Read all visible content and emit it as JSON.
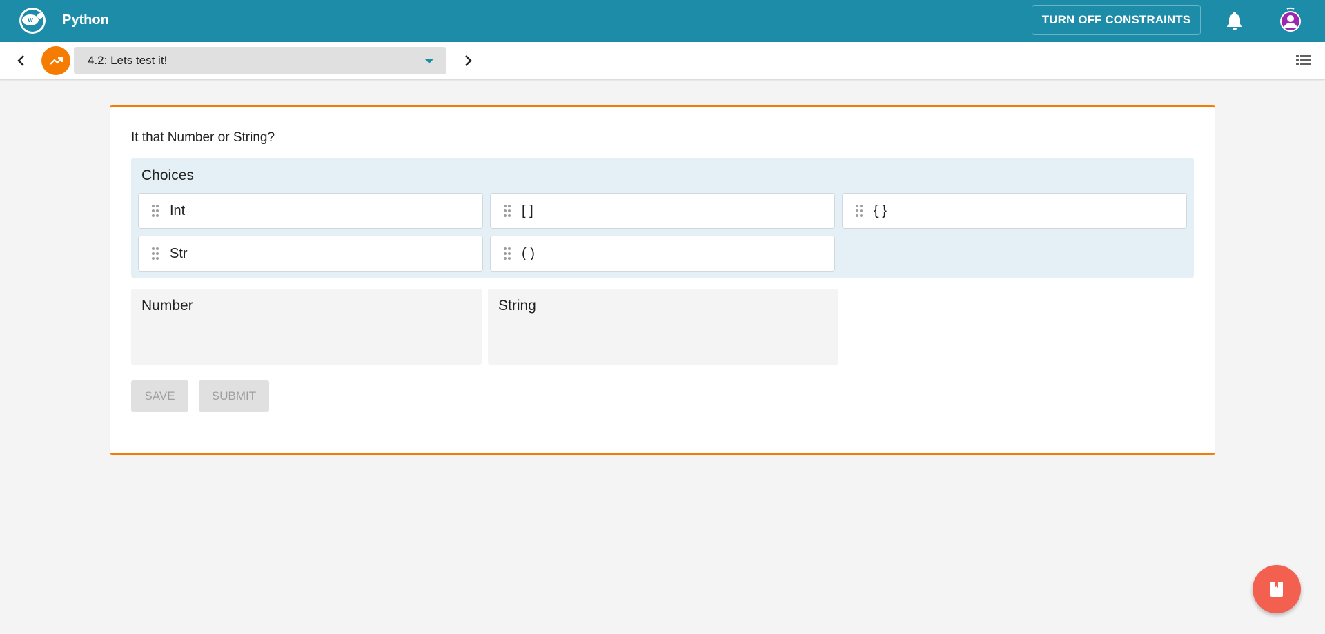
{
  "app": {
    "title": "Python",
    "constraints_label": "TURN OFF CONSTRAINTS"
  },
  "step": {
    "selected": "4.2: Lets test it!"
  },
  "question": {
    "prompt": "It that Number or String?",
    "choices_title": "Choices",
    "choices": [
      {
        "label": "Int"
      },
      {
        "label": "[ ]"
      },
      {
        "label": "{ }"
      },
      {
        "label": "Str"
      },
      {
        "label": "( )"
      }
    ],
    "buckets": [
      {
        "title": "Number"
      },
      {
        "title": "String"
      }
    ],
    "save_label": "SAVE",
    "submit_label": "SUBMIT"
  },
  "colors": {
    "primary": "#1c8ca8",
    "accent": "#f57c00",
    "choices_bg": "#e4f0f5",
    "fab": "#f4604f"
  }
}
